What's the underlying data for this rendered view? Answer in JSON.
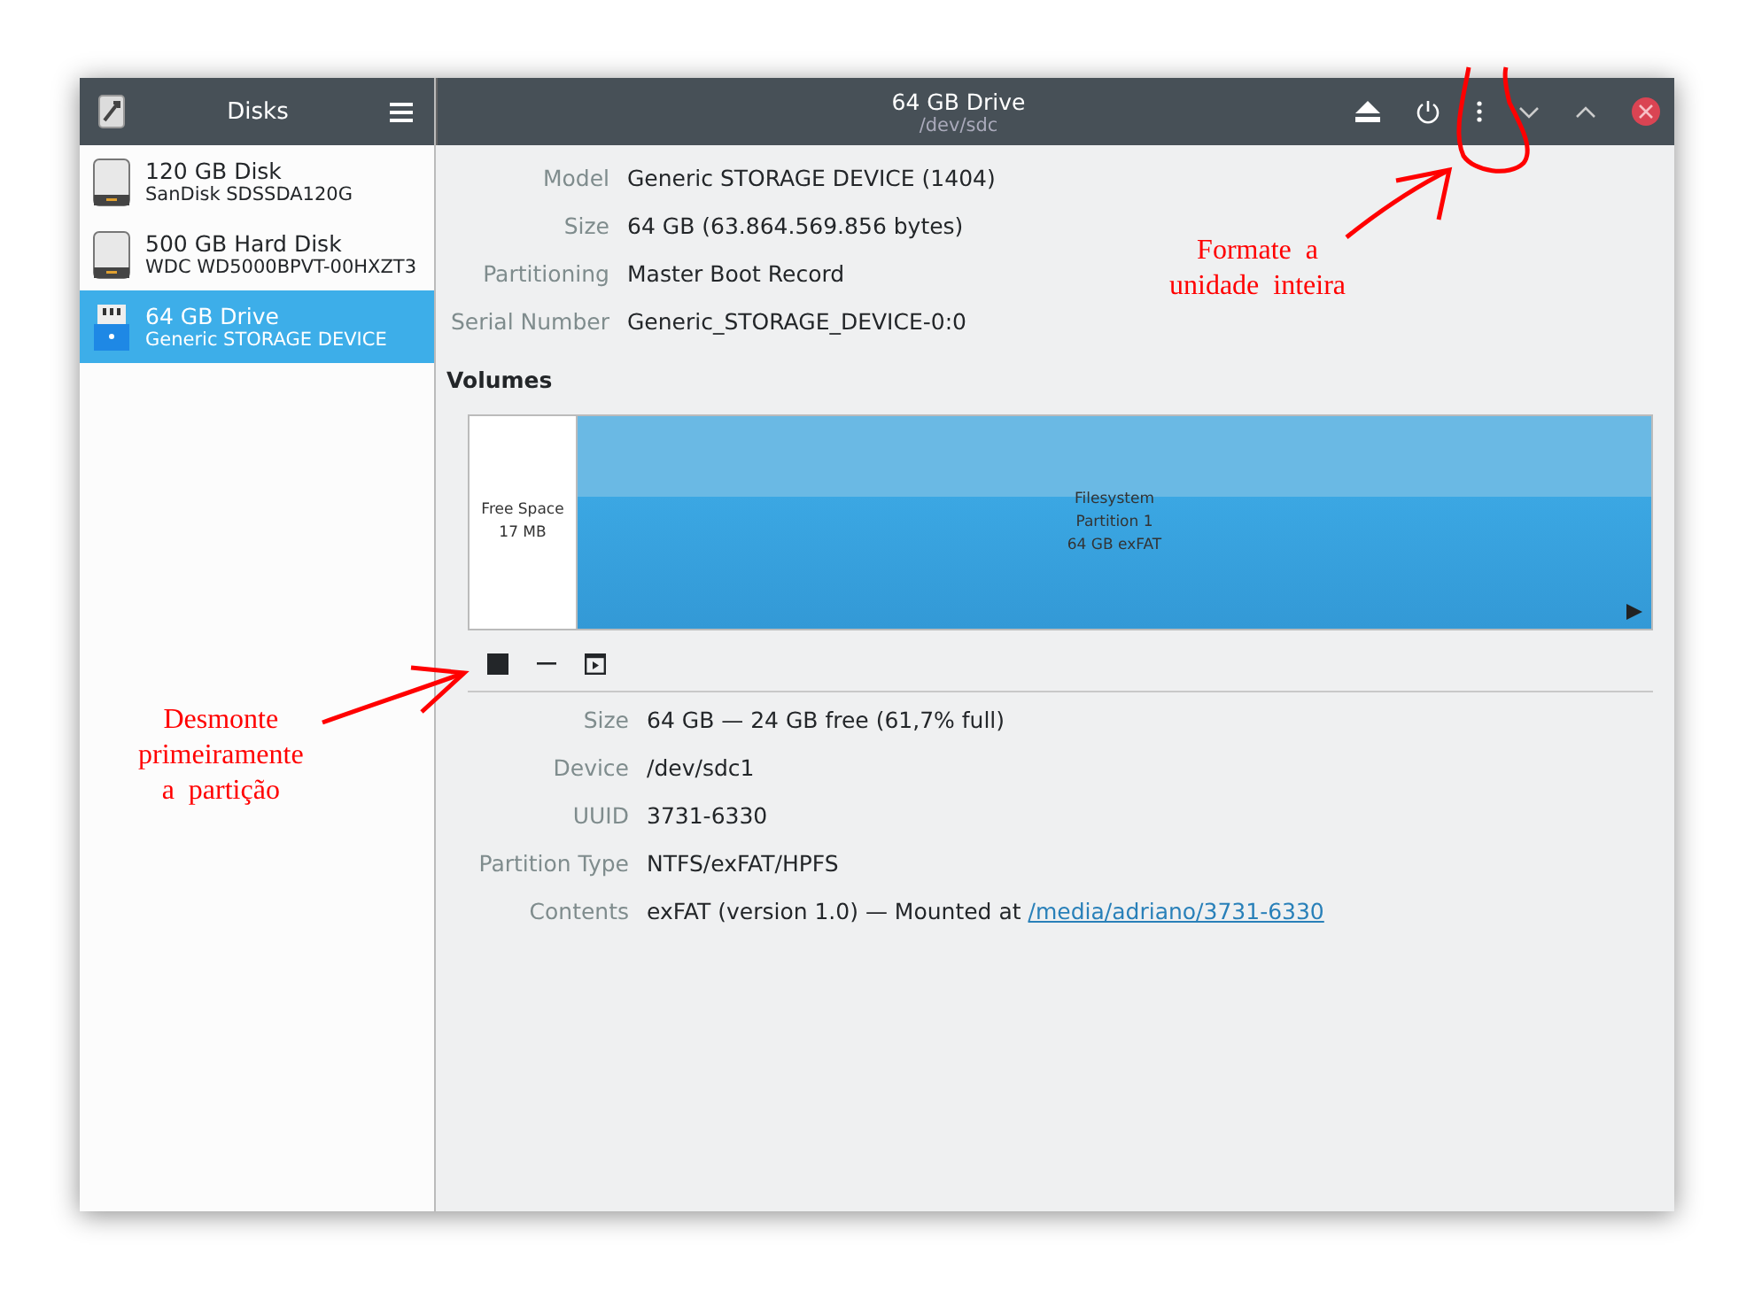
{
  "sidebar": {
    "title": "Disks",
    "disks": [
      {
        "kind": "hdd",
        "name": "120 GB Disk",
        "model": "SanDisk SDSSDA120G",
        "selected": false
      },
      {
        "kind": "hdd",
        "name": "500 GB Hard Disk",
        "model": "WDC WD5000BPVT-00HXZT3",
        "selected": false
      },
      {
        "kind": "usb",
        "name": "64 GB Drive",
        "model": "Generic STORAGE DEVICE",
        "selected": true
      }
    ]
  },
  "header": {
    "title": "64 GB Drive",
    "subtitle": "/dev/sdc"
  },
  "drive_info": [
    {
      "label": "Model",
      "value": "Generic STORAGE DEVICE (1404)"
    },
    {
      "label": "Size",
      "value": "64 GB (63.864.569.856 bytes)"
    },
    {
      "label": "Partitioning",
      "value": "Master Boot Record"
    },
    {
      "label": "Serial Number",
      "value": "Generic_STORAGE_DEVICE-0:0"
    }
  ],
  "volumes": {
    "title": "Volumes",
    "partitions": [
      {
        "kind": "free",
        "lines": [
          "Free Space",
          "17 MB"
        ],
        "selected": false
      },
      {
        "kind": "filesystem",
        "lines": [
          "Filesystem",
          "Partition 1",
          "64 GB exFAT"
        ],
        "selected": true
      }
    ]
  },
  "partition_info": [
    {
      "label": "Size",
      "value": "64 GB — 24 GB free (61,7% full)"
    },
    {
      "label": "Device",
      "value": "/dev/sdc1"
    },
    {
      "label": "UUID",
      "value": "3731-6330"
    },
    {
      "label": "Partition Type",
      "value": "NTFS/exFAT/HPFS"
    },
    {
      "label": "Contents",
      "value": "exFAT (version 1.0) — Mounted at ",
      "link": "/media/adriano/3731-6330"
    }
  ],
  "annotations": [
    {
      "lines": [
        "Formate  a",
        "unidade  inteira"
      ]
    },
    {
      "lines": [
        "Desmonte",
        "primeiramente",
        "a  partição"
      ]
    }
  ]
}
